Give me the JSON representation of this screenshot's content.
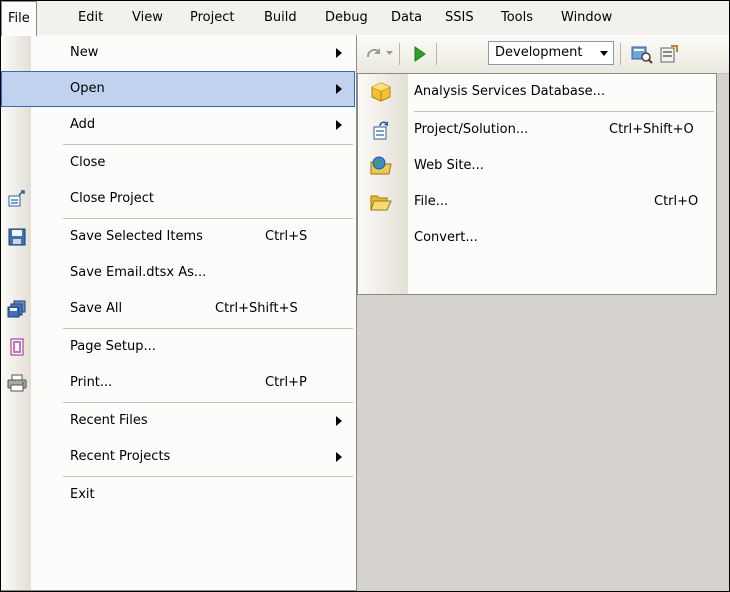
{
  "menubar": {
    "items": [
      "File",
      "Edit",
      "View",
      "Project",
      "Build",
      "Debug",
      "Data",
      "SSIS",
      "Tools",
      "Window"
    ],
    "active": "File"
  },
  "toolbar": {
    "configuration": "Development",
    "icons": [
      "redo-icon",
      "dropdown-icon",
      "start-debugging-icon",
      "solution-explorer-icon",
      "properties-icon"
    ]
  },
  "file_menu": {
    "new": "New",
    "open": "Open",
    "add": "Add",
    "close": "Close",
    "close_project": "Close Project",
    "save_selected": "Save Selected Items",
    "save_selected_shortcut": "Ctrl+S",
    "save_as": "Save Email.dtsx As...",
    "save_all": "Save All",
    "save_all_shortcut": "Ctrl+Shift+S",
    "page_setup": "Page Setup...",
    "print": "Print...",
    "print_shortcut": "Ctrl+P",
    "recent_files": "Recent Files",
    "recent_projects": "Recent Projects",
    "exit": "Exit"
  },
  "open_submenu": {
    "analysis_db": "Analysis Services Database...",
    "project_solution": "Project/Solution...",
    "project_solution_shortcut": "Ctrl+Shift+O",
    "web_site": "Web Site...",
    "file": "File...",
    "file_shortcut": "Ctrl+O",
    "convert": "Convert..."
  },
  "colors": {
    "highlight_fill": "#c1d2ee",
    "highlight_border": "#316ac5",
    "menu_bg": "#fcfcfb"
  }
}
